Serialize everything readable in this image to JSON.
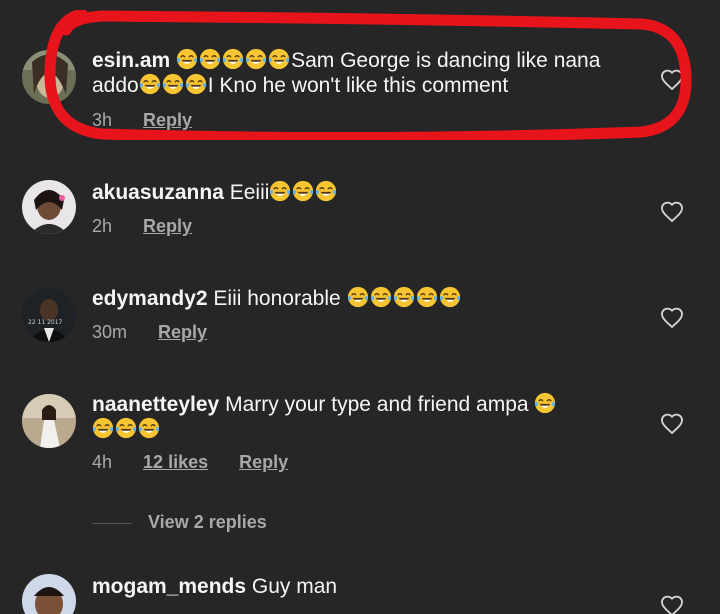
{
  "comments": [
    {
      "username": "esin.am",
      "segments": [
        {
          "type": "emoji",
          "count": 5
        },
        {
          "type": "text",
          "value": "Sam George is dancing like nana addo"
        },
        {
          "type": "emoji",
          "count": 3
        },
        {
          "type": "text",
          "value": "I Kno he won't like this comment"
        }
      ],
      "time": "3h",
      "likes": "",
      "reply_label": "Reply"
    },
    {
      "username": "akuasuzanna",
      "text": "Eeiii",
      "emoji_count": 3,
      "time": "2h",
      "likes": "",
      "reply_label": "Reply"
    },
    {
      "username": "edymandy2",
      "text": "Eiii honorable",
      "emoji_count": 5,
      "time": "30m",
      "likes": "",
      "reply_label": "Reply"
    },
    {
      "username": "naanetteyley",
      "text": "Marry your type and friend ampa",
      "emoji_count": 4,
      "time": "4h",
      "likes": "12 likes",
      "reply_label": "Reply"
    },
    {
      "username": "mogam_mends",
      "text": "Guy man",
      "emoji_count": 0,
      "time": "",
      "likes": "",
      "reply_label": ""
    }
  ],
  "view_replies_label": "View 2 replies",
  "emoji_icon": "face-with-tears-of-joy-icon",
  "heart_icon": "heart-outline-icon",
  "colors": {
    "background": "#262626",
    "text": "#f5f5f5",
    "muted": "#a8a8a8",
    "highlight": "#e8141b",
    "emoji": "#f7c531"
  }
}
